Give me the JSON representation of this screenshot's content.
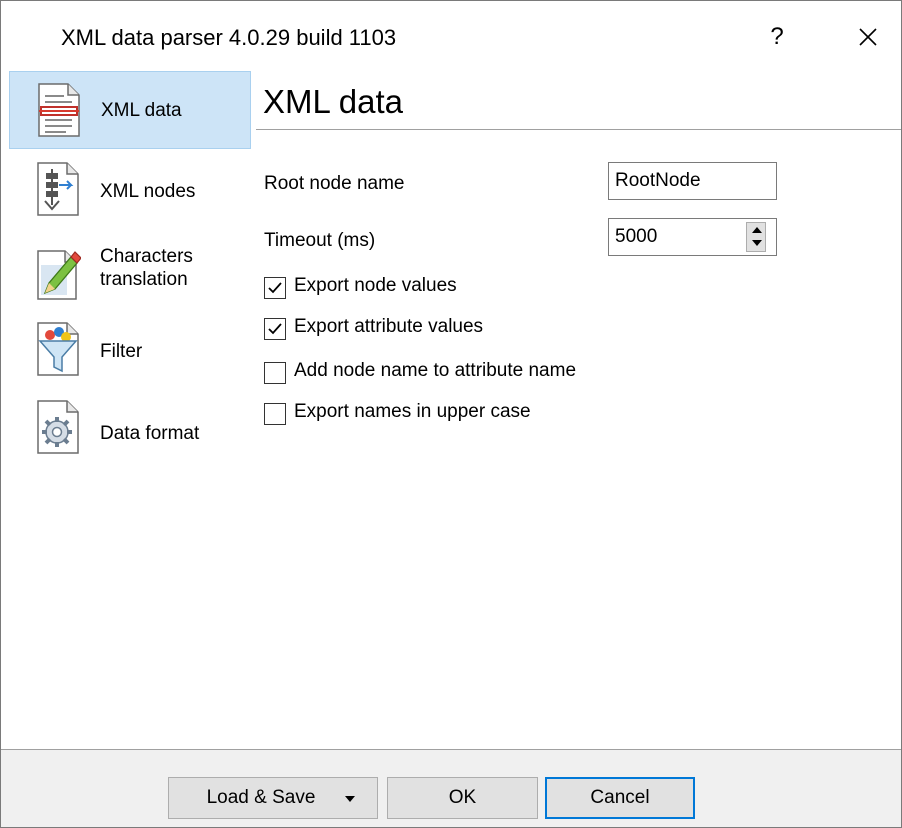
{
  "window": {
    "title": "XML data parser 4.0.29 build 1103",
    "help_label": "?"
  },
  "sidebar": {
    "items": [
      {
        "label": "XML data",
        "icon": "xml-document-icon",
        "selected": true
      },
      {
        "label": "XML nodes",
        "icon": "xml-nodes-icon",
        "selected": false
      },
      {
        "label": "Characters translation",
        "icon": "pencil-document-icon",
        "selected": false
      },
      {
        "label": "Filter",
        "icon": "filter-funnel-icon",
        "selected": false
      },
      {
        "label": "Data format",
        "icon": "gear-document-icon",
        "selected": false
      }
    ]
  },
  "main": {
    "title": "XML data",
    "root_node": {
      "label": "Root node name",
      "value": "RootNode"
    },
    "timeout": {
      "label": "Timeout (ms)",
      "value": "5000"
    },
    "checkboxes": [
      {
        "label": "Export node values",
        "checked": true
      },
      {
        "label": "Export attribute values",
        "checked": true
      },
      {
        "label": "Add node name to attribute name",
        "checked": false
      },
      {
        "label": "Export names in upper case",
        "checked": false
      }
    ]
  },
  "footer": {
    "load_save": "Load & Save",
    "ok": "OK",
    "cancel": "Cancel"
  },
  "colors": {
    "selection": "#cde4f7",
    "accent": "#0078d7",
    "footer_bg": "#f0f0f0"
  }
}
